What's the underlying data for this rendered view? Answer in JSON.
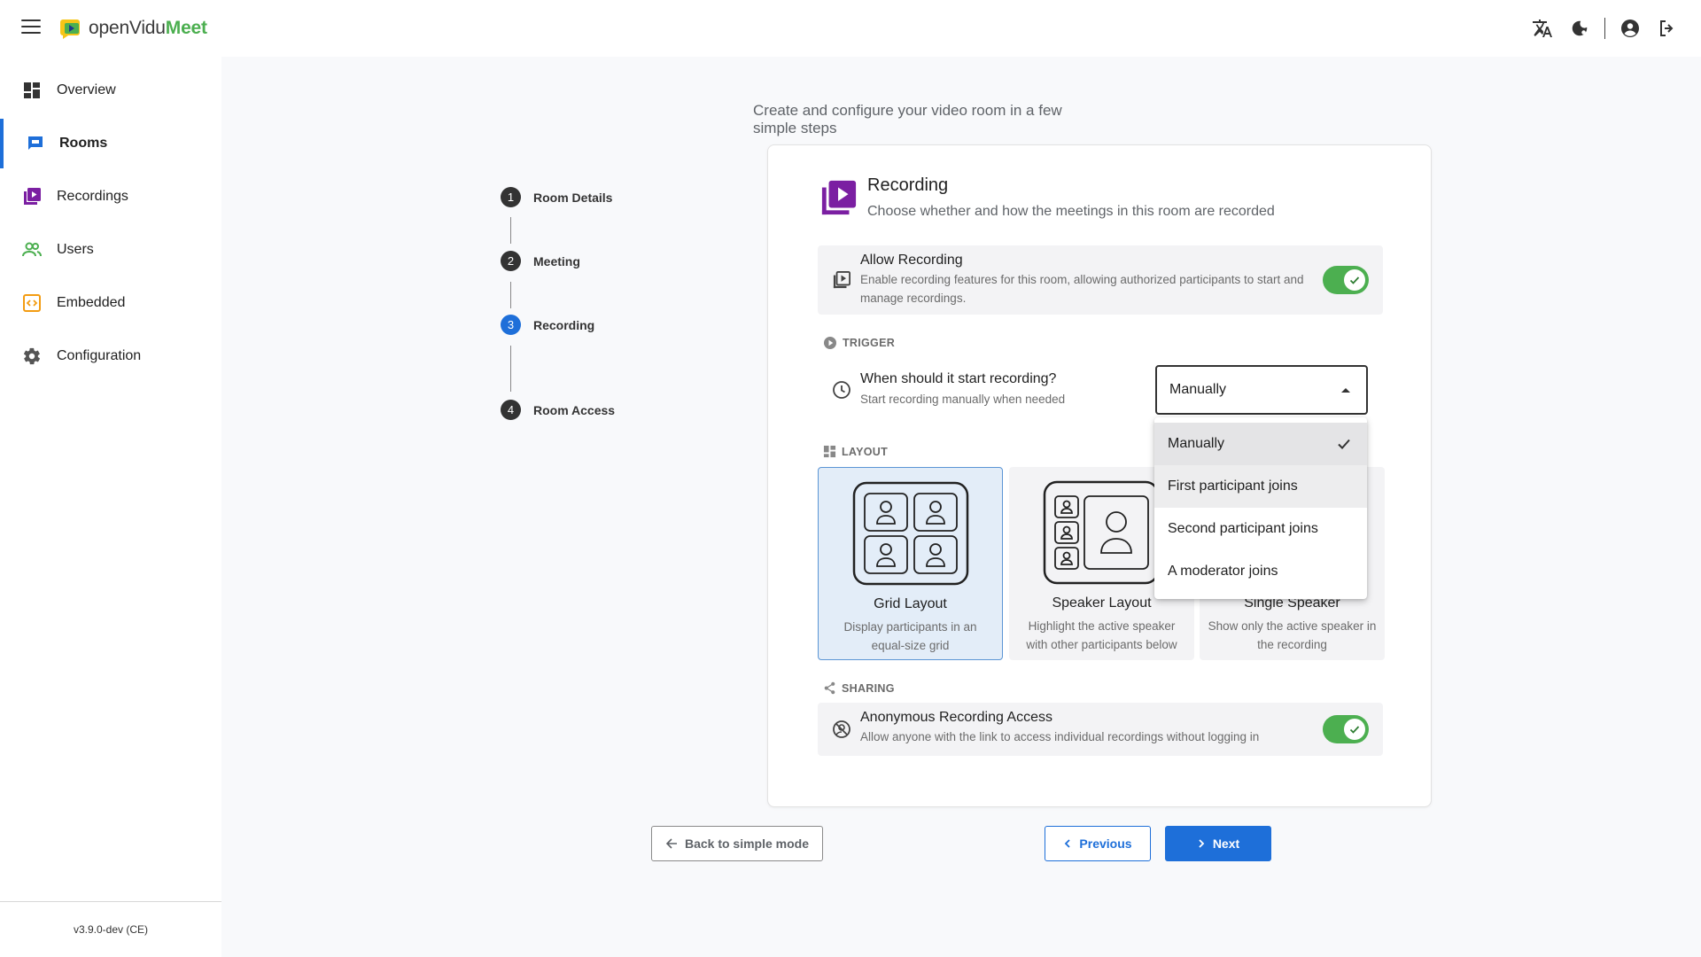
{
  "app": {
    "logo_part1": "openVidu",
    "logo_part2": "Meet",
    "version": "v3.9.0-dev (CE)"
  },
  "sidebar": {
    "items": [
      {
        "label": "Overview",
        "icon": "dashboard-icon"
      },
      {
        "label": "Rooms",
        "icon": "chat-icon",
        "active": true
      },
      {
        "label": "Recordings",
        "icon": "video-library-icon"
      },
      {
        "label": "Users",
        "icon": "people-icon"
      },
      {
        "label": "Embedded",
        "icon": "code-icon"
      },
      {
        "label": "Configuration",
        "icon": "gear-icon"
      }
    ]
  },
  "header": {
    "subtitle": "Create and configure your video room in a few simple steps"
  },
  "stepper": {
    "steps": [
      {
        "num": "1",
        "label": "Room Details"
      },
      {
        "num": "2",
        "label": "Meeting"
      },
      {
        "num": "3",
        "label": "Recording",
        "active": true
      },
      {
        "num": "4",
        "label": "Room Access"
      }
    ]
  },
  "card": {
    "title": "Recording",
    "subtitle": "Choose whether and how the meetings in this room are recorded",
    "allow": {
      "title": "Allow Recording",
      "desc": "Enable recording features for this room, allowing authorized participants to start and manage recordings.",
      "enabled": true
    },
    "trigger": {
      "section": "TRIGGER",
      "title": "When should it start recording?",
      "desc": "Start recording manually when needed",
      "selected": "Manually",
      "options": [
        "Manually",
        "First participant joins",
        "Second participant joins",
        "A moderator joins"
      ]
    },
    "layout": {
      "section": "LAYOUT",
      "options": [
        {
          "title": "Grid Layout",
          "desc": "Display participants in an equal-size grid",
          "selected": true
        },
        {
          "title": "Speaker Layout",
          "desc": "Highlight the active speaker with other participants below"
        },
        {
          "title": "Single Speaker",
          "desc": "Show only the active speaker in the recording"
        }
      ]
    },
    "sharing": {
      "section": "SHARING",
      "title": "Anonymous Recording Access",
      "desc": "Allow anyone with the link to access individual recordings without logging in",
      "enabled": true
    }
  },
  "buttons": {
    "back": "Back to simple mode",
    "previous": "Previous",
    "next": "Next"
  },
  "colors": {
    "accent": "#1e6fd9",
    "toggle_on": "#4caf50",
    "recording_purple": "#7b1fa2"
  }
}
